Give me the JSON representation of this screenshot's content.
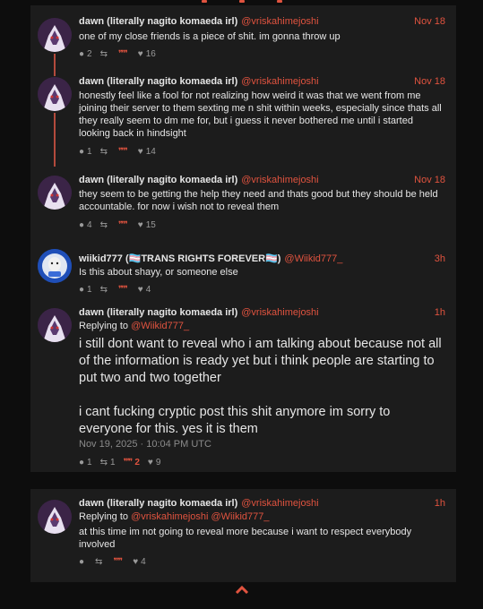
{
  "colors": {
    "accent": "#e0533f",
    "panel": "#1c1c1c",
    "background": "#0d0d0d",
    "thread_line": "#b34a3c"
  },
  "tweets": [
    {
      "name": "dawn (literally nagito komaeda irl)",
      "handle": "@vriskahimejoshi",
      "time": "Nov 18",
      "text": "one of my close friends is a piece of shit. im gonna throw up",
      "replies": "2",
      "retweets": "",
      "quotes": "",
      "likes": "16"
    },
    {
      "name": "dawn (literally nagito komaeda irl)",
      "handle": "@vriskahimejoshi",
      "time": "Nov 18",
      "text": "honestly feel like a fool for not realizing how weird it was that we went from me joining their server to them sexting me n shit within weeks, especially since thats all they really seem to dm me for, but i guess it never bothered me until i started looking back in hindsight",
      "replies": "1",
      "retweets": "",
      "quotes": "",
      "likes": "14"
    },
    {
      "name": "dawn (literally nagito komaeda irl)",
      "handle": "@vriskahimejoshi",
      "time": "Nov 18",
      "text": "they seem to be getting the help they need and thats good but they should be held accountable. for now i wish not to reveal them",
      "replies": "4",
      "retweets": "",
      "quotes": "",
      "likes": "15"
    },
    {
      "name": "wiikid777 (🏳️‍⚧️TRANS RIGHTS FOREVER🏳️‍⚧️)",
      "handle": "@Wiikid777_",
      "time": "3h",
      "text": "Is this about shayy, or someone else",
      "replies": "1",
      "retweets": "",
      "quotes": "",
      "likes": "4"
    },
    {
      "name": "dawn (literally nagito komaeda irl)",
      "handle": "@vriskahimejoshi",
      "time": "1h",
      "replying_prefix": "Replying to ",
      "replying_to": "@Wiikid777_",
      "text": "i still dont want to reveal who i am talking about because not all of the information is ready yet but i think people are starting to put two and two together",
      "text2": "i cant fucking cryptic post this shit anymore im sorry to everyone for this. yes it is them",
      "date": "Nov 19, 2025 · 10:04 PM UTC",
      "replies": "1",
      "retweets": "1",
      "quotes": "2",
      "likes": "9"
    },
    {
      "name": "dawn (literally nagito komaeda irl)",
      "handle": "@vriskahimejoshi",
      "time": "1h",
      "replying_prefix": "Replying to ",
      "replying_to": "@vriskahimejoshi @Wiikid777_",
      "text": "at this time im not going to reveal more because i want to respect everybody involved",
      "replies": "",
      "retweets": "",
      "quotes": "",
      "likes": "4"
    }
  ],
  "icons": {
    "reply": "💬",
    "retweet": "⇄",
    "quote": "❞❞",
    "like": "♥",
    "scroll_up": "⌃"
  },
  "glyphs": {
    "reply": "●",
    "retweet": "⇆",
    "quote": "❞",
    "like": "♥",
    "up": "︿"
  }
}
